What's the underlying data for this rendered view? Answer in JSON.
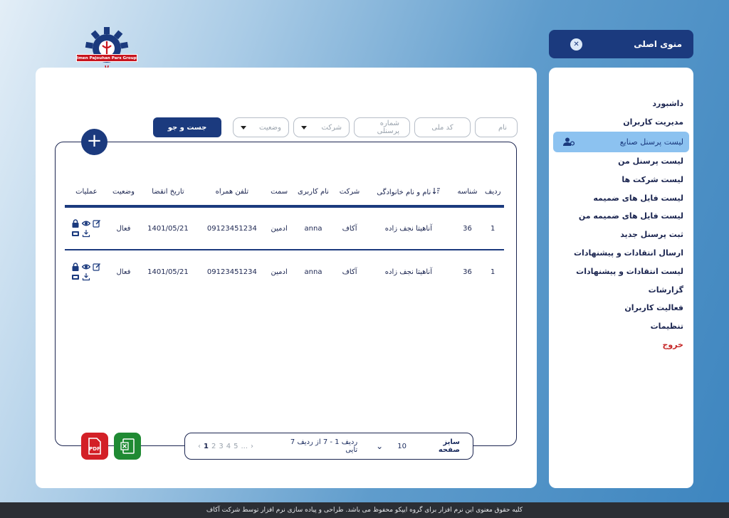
{
  "logo": {
    "company_text": "Imen Pajouhan Pars Group."
  },
  "menu_header": {
    "title": "منوی اصلی",
    "close_symbol": "✕"
  },
  "sidebar": {
    "items": [
      {
        "label": "داشبورد"
      },
      {
        "label": "مدیریت کاربران"
      },
      {
        "label": "لیست پرسنل صنایع",
        "active": true
      },
      {
        "label": "لیست پرسنل من"
      },
      {
        "label": "لیست شرکت ها"
      },
      {
        "label": "لیست فایل های ضمیمه"
      },
      {
        "label": "لیست فایل های ضمیمه من"
      },
      {
        "label": "ثبت پرسنل جدید"
      },
      {
        "label": "ارسال انتقادات و پیشنهادات"
      },
      {
        "label": "لیست انتقادات و پیشنهادات"
      },
      {
        "label": "گزارشات"
      },
      {
        "label": "فعالیت کاربران"
      },
      {
        "label": "تنظیمات"
      },
      {
        "label": "خروج"
      }
    ]
  },
  "filters": {
    "name_placeholder": "نام",
    "national_code_placeholder": "کد ملی",
    "personnel_no_placeholder": "شماره پرسنلی",
    "company_placeholder": "شرکت",
    "status_placeholder": "وضعیت",
    "search_label": "جست و جو"
  },
  "table": {
    "headers": [
      "ردیف",
      "شناسه",
      "نام و نام خانوادگی",
      "شرکت",
      "نام کاربری",
      "سمت",
      "تلفن همراه",
      "تاریخ انقضا",
      "وضعیت",
      "عملیات"
    ],
    "rows": [
      {
        "row": "1",
        "id": "36",
        "full_name": "آناهیتا نجف زاده",
        "company": "آکاف",
        "username": "anna",
        "position": "ادمین",
        "mobile": "09123451234",
        "expiry": "1401/05/21",
        "status": "فعال"
      },
      {
        "row": "1",
        "id": "36",
        "full_name": "آناهیتا نجف زاده",
        "company": "آکاف",
        "username": "anna",
        "position": "ادمین",
        "mobile": "09123451234",
        "expiry": "1401/05/21",
        "status": "فعال"
      }
    ]
  },
  "pager": {
    "size_label": "سایز صفحه",
    "size_value": "10",
    "range_text": "ردیف 1 - 7 از ردیف 7 تایی",
    "pages": [
      "1",
      "2",
      "3",
      "4",
      "5",
      "..."
    ],
    "current_page": "1"
  },
  "icons": {
    "pdf": "pdf-file-icon",
    "excel": "excel-file-icon",
    "add": "plus-icon",
    "lock": "lock-icon",
    "view": "eye-icon",
    "edit": "edit-icon",
    "card": "id-card-icon",
    "download": "download-icon",
    "sort": "sort-icon",
    "active_item": "user-settings-icon"
  },
  "colors": {
    "primary": "#1b3a7e",
    "active_bg": "#8cc2f0",
    "logout": "#c62828",
    "pdf": "#d32027",
    "excel": "#1f8a33"
  },
  "footer_text": "کلیه حقوق معنوی این نرم افزار برای گروه ایپکو محفوظ می باشد. طراحی و پیاده سازی نرم افزار توسط شرکت آکاف"
}
